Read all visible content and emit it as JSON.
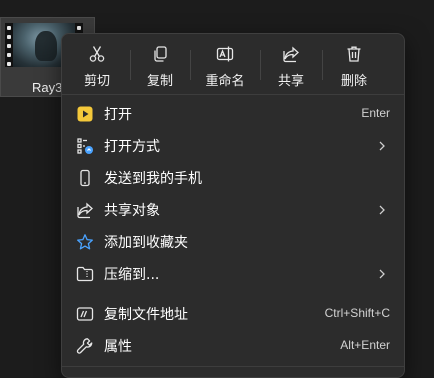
{
  "file": {
    "name": "Ray3"
  },
  "toolbar": {
    "cut": "剪切",
    "copy": "复制",
    "rename": "重命名",
    "share": "共享",
    "delete": "删除"
  },
  "menu": {
    "items": [
      {
        "label": "打开",
        "shortcut": "Enter",
        "icon": "open-app-icon"
      },
      {
        "label": "打开方式",
        "icon": "open-with-icon",
        "submenu": true
      },
      {
        "label": "发送到我的手机",
        "icon": "phone-icon"
      },
      {
        "label": "共享对象",
        "icon": "share-icon",
        "submenu": true
      },
      {
        "label": "添加到收藏夹",
        "icon": "star-icon"
      },
      {
        "label": "压缩到...",
        "icon": "zip-folder-icon",
        "submenu": true
      },
      {
        "label": "复制文件地址",
        "shortcut": "Ctrl+Shift+C",
        "icon": "copy-path-icon"
      },
      {
        "label": "属性",
        "shortcut": "Alt+Enter",
        "icon": "wrench-icon"
      }
    ]
  },
  "colors": {
    "menu_bg": "#2c2c2c",
    "accent_yellow": "#f4c83a",
    "accent_blue": "#4aa3ff"
  }
}
